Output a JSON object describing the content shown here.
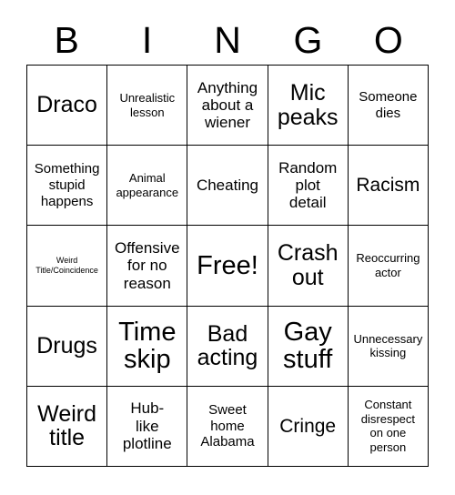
{
  "card": {
    "title": "BINGO",
    "header_letters": [
      "B",
      "I",
      "N",
      "G",
      "O"
    ],
    "grid_size": "5x5",
    "free_space_index": 12,
    "colors": {
      "background": "#ffffff",
      "border": "#000000",
      "text": "#000000"
    },
    "cells": [
      {
        "text": "Draco",
        "size": "xxl"
      },
      {
        "text": "Unrealistic\nlesson",
        "size": "sm"
      },
      {
        "text": "Anything\nabout a\nwiener",
        "size": "lg"
      },
      {
        "text": "Mic\npeaks",
        "size": "xxl"
      },
      {
        "text": "Someone\ndies",
        "size": "md"
      },
      {
        "text": "Something\nstupid\nhappens",
        "size": "md"
      },
      {
        "text": "Animal\nappearance",
        "size": "sm"
      },
      {
        "text": "Cheating",
        "size": "lg"
      },
      {
        "text": "Random\nplot\ndetail",
        "size": "lg"
      },
      {
        "text": "Racism",
        "size": "xl"
      },
      {
        "text": "Weird\nTitle/Coincidence",
        "size": "xs"
      },
      {
        "text": "Offensive\nfor no\nreason",
        "size": "lg"
      },
      {
        "text": "Free!",
        "size": "huge"
      },
      {
        "text": "Crash\nout",
        "size": "xxl"
      },
      {
        "text": "Reoccurring\nactor",
        "size": "sm"
      },
      {
        "text": "Drugs",
        "size": "xxl"
      },
      {
        "text": "Time\nskip",
        "size": "huge"
      },
      {
        "text": "Bad\nacting",
        "size": "xxl"
      },
      {
        "text": "Gay\nstuff",
        "size": "huge"
      },
      {
        "text": "Unnecessary\nkissing",
        "size": "sm"
      },
      {
        "text": "Weird\ntitle",
        "size": "xxl"
      },
      {
        "text": "Hub-\nlike\nplotline",
        "size": "lg"
      },
      {
        "text": "Sweet\nhome\nAlabama",
        "size": "md"
      },
      {
        "text": "Cringe",
        "size": "xl"
      },
      {
        "text": "Constant\ndisrespect\non one\nperson",
        "size": "sm"
      }
    ]
  }
}
